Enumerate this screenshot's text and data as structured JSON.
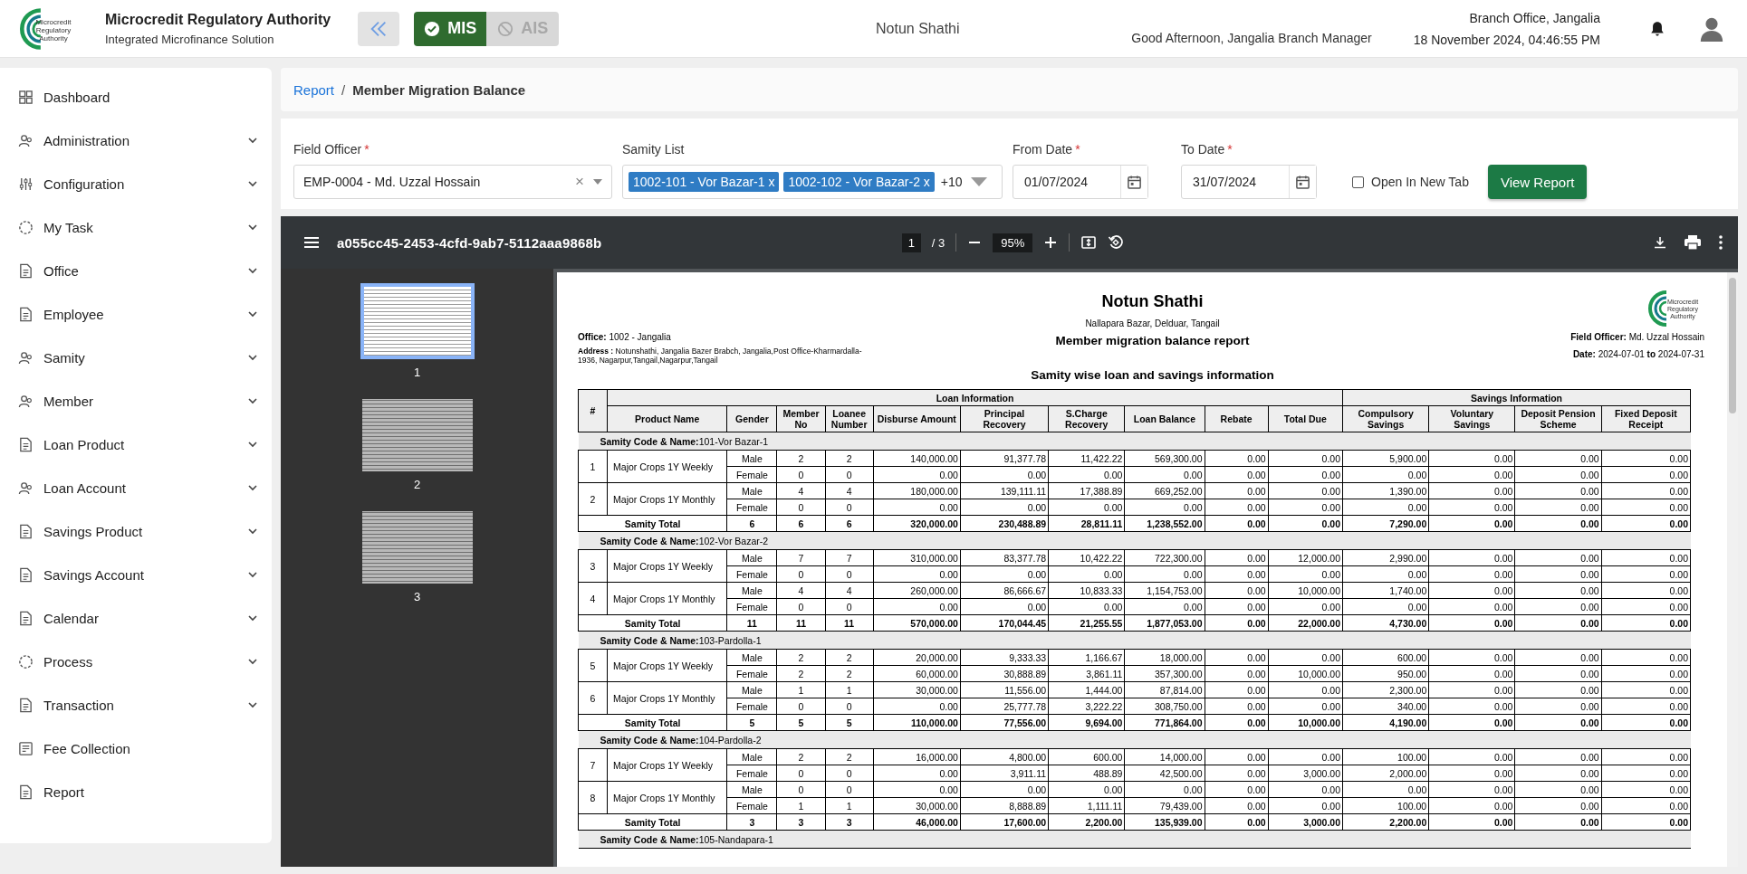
{
  "header": {
    "logo_text": "Microcredit Regulatory Authority",
    "org_title": "Microcredit Regulatory Authority",
    "org_subtitle": "Integrated Microfinance Solution",
    "modules": [
      {
        "label": "MIS",
        "selected": true
      },
      {
        "label": "AIS",
        "selected": false
      }
    ],
    "center_title": "Notun Shathi",
    "greeting": "Good Afternoon, Jangalia Branch Manager",
    "branch": "Branch Office, Jangalia",
    "datetime": "18 November 2024, 04:46:55 PM"
  },
  "sidebar": {
    "items": [
      {
        "label": "Dashboard",
        "kind": "link"
      },
      {
        "label": "Administration",
        "kind": "group"
      },
      {
        "label": "Configuration",
        "kind": "group"
      },
      {
        "label": "My Task",
        "kind": "group"
      },
      {
        "label": "Office",
        "kind": "group"
      },
      {
        "label": "Employee",
        "kind": "group"
      },
      {
        "label": "Samity",
        "kind": "group"
      },
      {
        "label": "Member",
        "kind": "group"
      },
      {
        "label": "Loan Product",
        "kind": "group"
      },
      {
        "label": "Loan Account",
        "kind": "group"
      },
      {
        "label": "Savings Product",
        "kind": "group"
      },
      {
        "label": "Savings Account",
        "kind": "group"
      },
      {
        "label": "Calendar",
        "kind": "group"
      },
      {
        "label": "Process",
        "kind": "group"
      },
      {
        "label": "Transaction",
        "kind": "group"
      },
      {
        "label": "Fee Collection",
        "kind": "link"
      },
      {
        "label": "Report",
        "kind": "link"
      }
    ]
  },
  "breadcrumb": {
    "items": [
      {
        "label": "Report",
        "kind": "link"
      },
      {
        "label": "Member Migration Balance",
        "kind": "current"
      }
    ],
    "separator": "/"
  },
  "filters": {
    "field_officer": {
      "label": "Field Officer",
      "mark": "*",
      "value": "EMP-0004 - Md. Uzzal Hossain",
      "clear": "×"
    },
    "samity_list": {
      "label": "Samity List",
      "chips": [
        {
          "label": "1002-101 - Vor Bazar-1",
          "remove": "x"
        },
        {
          "label": "1002-102 - Vor Bazar-2",
          "remove": "x"
        }
      ],
      "more": "+10"
    },
    "from_date": {
      "label": "From Date",
      "mark": "*",
      "value": "01/07/2024"
    },
    "to_date": {
      "label": "To Date",
      "mark": "*",
      "value": "31/07/2024"
    },
    "open_in_new_tab": {
      "label": "Open In New Tab",
      "checked": false
    },
    "submit": "View Report"
  },
  "viewer": {
    "file_name": "a055cc45-2453-4cfd-9ab7-5112aaa9868b",
    "page": "1",
    "page_count": "/ 3",
    "zoom": "95%",
    "thumbnails": [
      {
        "label": "1",
        "selected": true
      },
      {
        "label": "2",
        "selected": false
      },
      {
        "label": "3",
        "selected": false
      }
    ],
    "report": {
      "org_name": "Notun Shathi",
      "org_address": "Nallapara Bazar, Delduar, Tangail",
      "logo_text": "Microcredit Regulatory Authority",
      "office": "**Office:** 1002 - Jangalia",
      "address": "**Address :** Notunshathi, Jangalia Bazer Brabch, Jangalia,Post Office-Kharmardalla-1936, Nagarpur,Tangail,Nagarpur,Tangail",
      "title": "Member migration balance report",
      "subtitle": "Samity wise loan and savings information",
      "field_officer": "**Field Officer:** Md. Uzzal Hossain",
      "date": "**Date:** 2024-07-01 **to** 2024-07-31",
      "table": {
        "corner": "#",
        "groups": [
          {
            "label": "Loan Information",
            "columns": [
              "Product Name",
              "Gender",
              "Member No",
              "Loanee Number",
              "Disburse Amount",
              "Principal Recovery",
              "S.Charge Recovery",
              "Loan Balance",
              "Rebate",
              "Total Due"
            ]
          },
          {
            "label": "Savings Information",
            "columns": [
              "Compulsory Savings",
              "Voluntary Savings",
              "Deposit Pension Scheme",
              "Fixed Deposit Receipt"
            ]
          }
        ],
        "samities": [
          {
            "title": "**Samity Code & Name:**101-Vor Bazar-1",
            "products": [
              {
                "no": "1",
                "name": "Major Crops 1Y Weekly",
                "rows": [
                  [
                    "Male",
                    "2",
                    "2",
                    "140,000.00",
                    "91,377.78",
                    "11,422.22",
                    "569,300.00",
                    "0.00",
                    "0.00",
                    "5,900.00",
                    "0.00",
                    "0.00",
                    "0.00"
                  ],
                  [
                    "Female",
                    "0",
                    "0",
                    "0.00",
                    "0.00",
                    "0.00",
                    "0.00",
                    "0.00",
                    "0.00",
                    "0.00",
                    "0.00",
                    "0.00",
                    "0.00"
                  ]
                ]
              },
              {
                "no": "2",
                "name": "Major Crops 1Y Monthly",
                "rows": [
                  [
                    "Male",
                    "4",
                    "4",
                    "180,000.00",
                    "139,111.11",
                    "17,388.89",
                    "669,252.00",
                    "0.00",
                    "0.00",
                    "1,390.00",
                    "0.00",
                    "0.00",
                    "0.00"
                  ],
                  [
                    "Female",
                    "0",
                    "0",
                    "0.00",
                    "0.00",
                    "0.00",
                    "0.00",
                    "0.00",
                    "0.00",
                    "0.00",
                    "0.00",
                    "0.00",
                    "0.00"
                  ]
                ]
              }
            ],
            "total_label": "Samity Total",
            "totals": [
              "6",
              "6",
              "6",
              "320,000.00",
              "230,488.89",
              "28,811.11",
              "1,238,552.00",
              "0.00",
              "0.00",
              "7,290.00",
              "0.00",
              "0.00",
              "0.00"
            ]
          },
          {
            "title": "**Samity Code & Name:**102-Vor Bazar-2",
            "products": [
              {
                "no": "3",
                "name": "Major Crops 1Y Weekly",
                "rows": [
                  [
                    "Male",
                    "7",
                    "7",
                    "310,000.00",
                    "83,377.78",
                    "10,422.22",
                    "722,300.00",
                    "0.00",
                    "12,000.00",
                    "2,990.00",
                    "0.00",
                    "0.00",
                    "0.00"
                  ],
                  [
                    "Female",
                    "0",
                    "0",
                    "0.00",
                    "0.00",
                    "0.00",
                    "0.00",
                    "0.00",
                    "0.00",
                    "0.00",
                    "0.00",
                    "0.00",
                    "0.00"
                  ]
                ]
              },
              {
                "no": "4",
                "name": "Major Crops 1Y Monthly",
                "rows": [
                  [
                    "Male",
                    "4",
                    "4",
                    "260,000.00",
                    "86,666.67",
                    "10,833.33",
                    "1,154,753.00",
                    "0.00",
                    "10,000.00",
                    "1,740.00",
                    "0.00",
                    "0.00",
                    "0.00"
                  ],
                  [
                    "Female",
                    "0",
                    "0",
                    "0.00",
                    "0.00",
                    "0.00",
                    "0.00",
                    "0.00",
                    "0.00",
                    "0.00",
                    "0.00",
                    "0.00",
                    "0.00"
                  ]
                ]
              }
            ],
            "total_label": "Samity Total",
            "totals": [
              "11",
              "11",
              "11",
              "570,000.00",
              "170,044.45",
              "21,255.55",
              "1,877,053.00",
              "0.00",
              "22,000.00",
              "4,730.00",
              "0.00",
              "0.00",
              "0.00"
            ]
          },
          {
            "title": "**Samity Code & Name:**103-Pardolla-1",
            "products": [
              {
                "no": "5",
                "name": "Major Crops 1Y Weekly",
                "rows": [
                  [
                    "Male",
                    "2",
                    "2",
                    "20,000.00",
                    "9,333.33",
                    "1,166.67",
                    "18,000.00",
                    "0.00",
                    "0.00",
                    "600.00",
                    "0.00",
                    "0.00",
                    "0.00"
                  ],
                  [
                    "Female",
                    "2",
                    "2",
                    "60,000.00",
                    "30,888.89",
                    "3,861.11",
                    "357,300.00",
                    "0.00",
                    "10,000.00",
                    "950.00",
                    "0.00",
                    "0.00",
                    "0.00"
                  ]
                ]
              },
              {
                "no": "6",
                "name": "Major Crops 1Y Monthly",
                "rows": [
                  [
                    "Male",
                    "1",
                    "1",
                    "30,000.00",
                    "11,556.00",
                    "1,444.00",
                    "87,814.00",
                    "0.00",
                    "0.00",
                    "2,300.00",
                    "0.00",
                    "0.00",
                    "0.00"
                  ],
                  [
                    "Female",
                    "0",
                    "0",
                    "0.00",
                    "25,777.78",
                    "3,222.22",
                    "308,750.00",
                    "0.00",
                    "0.00",
                    "340.00",
                    "0.00",
                    "0.00",
                    "0.00"
                  ]
                ]
              }
            ],
            "total_label": "Samity Total",
            "totals": [
              "5",
              "5",
              "5",
              "110,000.00",
              "77,556.00",
              "9,694.00",
              "771,864.00",
              "0.00",
              "10,000.00",
              "4,190.00",
              "0.00",
              "0.00",
              "0.00"
            ]
          },
          {
            "title": "**Samity Code & Name:**104-Pardolla-2",
            "products": [
              {
                "no": "7",
                "name": "Major Crops 1Y Weekly",
                "rows": [
                  [
                    "Male",
                    "2",
                    "2",
                    "16,000.00",
                    "4,800.00",
                    "600.00",
                    "14,000.00",
                    "0.00",
                    "0.00",
                    "100.00",
                    "0.00",
                    "0.00",
                    "0.00"
                  ],
                  [
                    "Female",
                    "0",
                    "0",
                    "0.00",
                    "3,911.11",
                    "488.89",
                    "42,500.00",
                    "0.00",
                    "3,000.00",
                    "2,000.00",
                    "0.00",
                    "0.00",
                    "0.00"
                  ]
                ]
              },
              {
                "no": "8",
                "name": "Major Crops 1Y Monthly",
                "rows": [
                  [
                    "Male",
                    "0",
                    "0",
                    "0.00",
                    "0.00",
                    "0.00",
                    "0.00",
                    "0.00",
                    "0.00",
                    "0.00",
                    "0.00",
                    "0.00",
                    "0.00"
                  ],
                  [
                    "Female",
                    "1",
                    "1",
                    "30,000.00",
                    "8,888.89",
                    "1,111.11",
                    "79,439.00",
                    "0.00",
                    "0.00",
                    "100.00",
                    "0.00",
                    "0.00",
                    "0.00"
                  ]
                ]
              }
            ],
            "total_label": "Samity Total",
            "totals": [
              "3",
              "3",
              "3",
              "46,000.00",
              "17,600.00",
              "2,200.00",
              "135,939.00",
              "0.00",
              "3,000.00",
              "2,200.00",
              "0.00",
              "0.00",
              "0.00"
            ]
          },
          {
            "title": "**Samity Code & Name:**105-Nandapara-1"
          }
        ]
      }
    }
  }
}
